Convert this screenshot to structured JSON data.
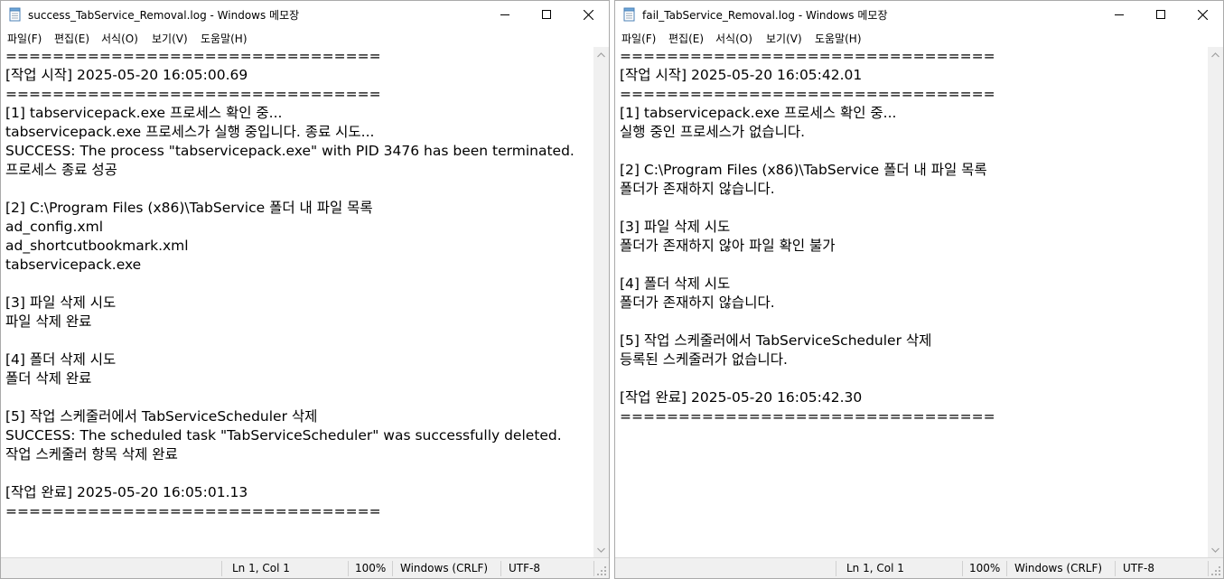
{
  "windows": [
    {
      "title": "success_TabService_Removal.log - Windows 메모장",
      "menu": {
        "file": "파일(F)",
        "edit": "편집(E)",
        "format": "서식(O)",
        "view": "보기(V)",
        "help": "도움말(H)"
      },
      "lines": [
        "================================",
        "[작업 시작] 2025-05-20 16:05:00.69",
        "================================",
        "[1] tabservicepack.exe 프로세스 확인 중...",
        "tabservicepack.exe 프로세스가 실행 중입니다. 종료 시도...",
        "SUCCESS: The process \"tabservicepack.exe\" with PID 3476 has been terminated.",
        "프로세스 종료 성공",
        "",
        "[2] C:\\Program Files (x86)\\TabService 폴더 내 파일 목록",
        "ad_config.xml",
        "ad_shortcutbookmark.xml",
        "tabservicepack.exe",
        "",
        "[3] 파일 삭제 시도",
        "파일 삭제 완료",
        "",
        "[4] 폴더 삭제 시도",
        "폴더 삭제 완료",
        "",
        "[5] 작업 스케줄러에서 TabServiceScheduler 삭제",
        "SUCCESS: The scheduled task \"TabServiceScheduler\" was successfully deleted.",
        "작업 스케줄러 항목 삭제 완료",
        "",
        "[작업 완료] 2025-05-20 16:05:01.13",
        "================================"
      ],
      "status": {
        "position": "Ln 1, Col 1",
        "zoom": "100%",
        "line_ending": "Windows (CRLF)",
        "encoding": "UTF-8"
      }
    },
    {
      "title": "fail_TabService_Removal.log - Windows 메모장",
      "menu": {
        "file": "파일(F)",
        "edit": "편집(E)",
        "format": "서식(O)",
        "view": "보기(V)",
        "help": "도움말(H)"
      },
      "lines": [
        "================================",
        "[작업 시작] 2025-05-20 16:05:42.01",
        "================================",
        "[1] tabservicepack.exe 프로세스 확인 중...",
        "실행 중인 프로세스가 없습니다.",
        "",
        "[2] C:\\Program Files (x86)\\TabService 폴더 내 파일 목록",
        "폴더가 존재하지 않습니다.",
        "",
        "[3] 파일 삭제 시도",
        "폴더가 존재하지 않아 파일 확인 불가",
        "",
        "[4] 폴더 삭제 시도",
        "폴더가 존재하지 않습니다.",
        "",
        "[5] 작업 스케줄러에서 TabServiceScheduler 삭제",
        "등록된 스케줄러가 없습니다.",
        "",
        "[작업 완료] 2025-05-20 16:05:42.30",
        "================================"
      ],
      "status": {
        "position": "Ln 1, Col 1",
        "zoom": "100%",
        "line_ending": "Windows (CRLF)",
        "encoding": "UTF-8"
      }
    }
  ]
}
